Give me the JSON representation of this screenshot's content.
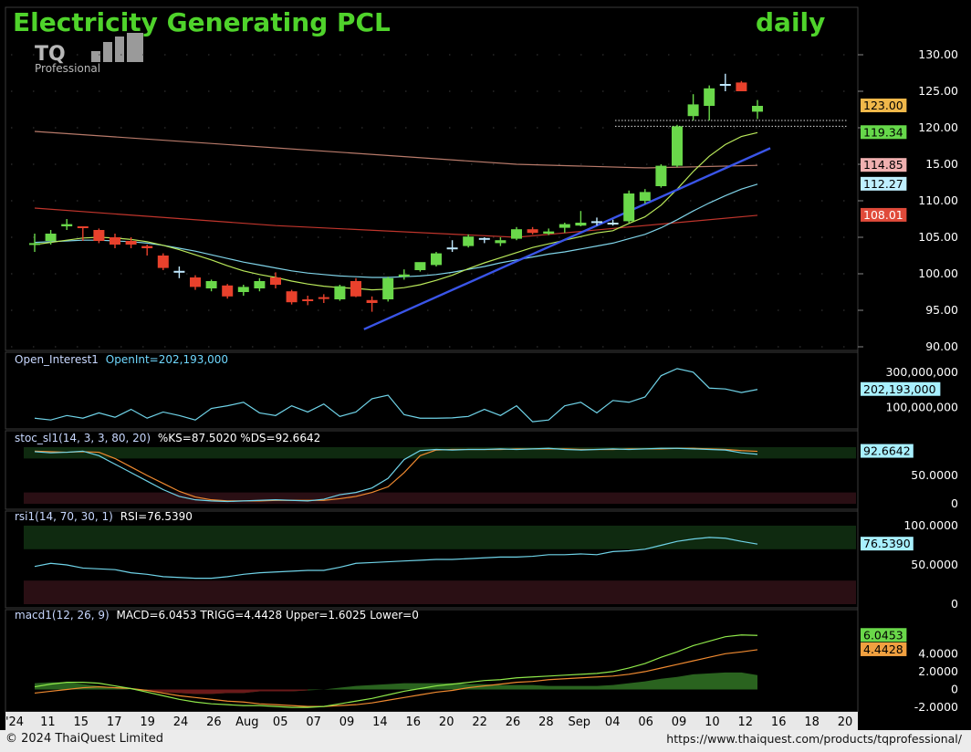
{
  "header": {
    "title": "Electricity Generating PCL",
    "period": "daily",
    "logo_text": "TQ",
    "logo_sub": "Professional"
  },
  "footer": {
    "copyright": "© 2024 ThaiQuest Limited",
    "url": "https://www.thaiquest.com/products/tqprofessional/"
  },
  "colors": {
    "background": "#000000",
    "title": "#4fd32b",
    "bull": "#6ad84a",
    "bear": "#e8412c",
    "doji": "#bfe8ff",
    "trendline": "#3a55e8",
    "ma_green": "#b9e85a",
    "ma_cyan": "#7fd3e8",
    "ma_red": "#c0352c",
    "ma_brown": "#b87a6a"
  },
  "chart_data": [
    {
      "type": "candlestick",
      "title": "Electricity Generating PCL daily",
      "x_labels": [
        "'24",
        "11",
        "15",
        "17",
        "19",
        "24",
        "26",
        "Aug",
        "05",
        "07",
        "09",
        "14",
        "16",
        "20",
        "22",
        "26",
        "28",
        "Sep",
        "04",
        "06",
        "09",
        "10",
        "12",
        "16",
        "18",
        "20"
      ],
      "ylim": [
        90,
        130
      ],
      "y_ticks": [
        "130.00",
        "125.00",
        "120.00",
        "15.00",
        "110.00",
        "105.00",
        "100.00",
        "95.00",
        "90.00"
      ],
      "candles": [
        {
          "o": 104.0,
          "h": 105.5,
          "l": 103.0,
          "c": 104.2
        },
        {
          "o": 104.5,
          "h": 106.0,
          "l": 104.0,
          "c": 105.5
        },
        {
          "o": 106.5,
          "h": 107.5,
          "l": 106.0,
          "c": 106.8
        },
        {
          "o": 106.5,
          "h": 106.5,
          "l": 104.5,
          "c": 106.3
        },
        {
          "o": 106.0,
          "h": 106.2,
          "l": 104.2,
          "c": 104.5
        },
        {
          "o": 105.0,
          "h": 105.5,
          "l": 103.5,
          "c": 104.0
        },
        {
          "o": 104.5,
          "h": 105.0,
          "l": 103.5,
          "c": 104.0
        },
        {
          "o": 103.8,
          "h": 104.0,
          "l": 102.5,
          "c": 103.5
        },
        {
          "o": 102.5,
          "h": 102.8,
          "l": 100.5,
          "c": 100.8
        },
        {
          "o": 100.4,
          "h": 101.0,
          "l": 99.4,
          "c": 100.3
        },
        {
          "o": 99.5,
          "h": 99.8,
          "l": 97.8,
          "c": 98.2
        },
        {
          "o": 98.0,
          "h": 99.2,
          "l": 97.6,
          "c": 99.0
        },
        {
          "o": 98.4,
          "h": 98.6,
          "l": 96.6,
          "c": 96.9
        },
        {
          "o": 97.5,
          "h": 98.5,
          "l": 97.0,
          "c": 98.2
        },
        {
          "o": 98.0,
          "h": 99.4,
          "l": 97.6,
          "c": 99.0
        },
        {
          "o": 99.5,
          "h": 100.2,
          "l": 98.0,
          "c": 98.5
        },
        {
          "o": 97.6,
          "h": 97.8,
          "l": 95.8,
          "c": 96.1
        },
        {
          "o": 96.5,
          "h": 97.0,
          "l": 95.7,
          "c": 96.3
        },
        {
          "o": 96.8,
          "h": 97.2,
          "l": 96.0,
          "c": 96.6
        },
        {
          "o": 96.5,
          "h": 98.5,
          "l": 96.3,
          "c": 98.3
        },
        {
          "o": 99.0,
          "h": 99.4,
          "l": 96.8,
          "c": 96.9
        },
        {
          "o": 96.4,
          "h": 96.9,
          "l": 94.8,
          "c": 96.0
        },
        {
          "o": 96.5,
          "h": 99.6,
          "l": 96.2,
          "c": 99.4
        },
        {
          "o": 99.6,
          "h": 100.6,
          "l": 99.2,
          "c": 99.9
        },
        {
          "o": 100.5,
          "h": 101.5,
          "l": 100.3,
          "c": 101.6
        },
        {
          "o": 101.2,
          "h": 103.0,
          "l": 101.0,
          "c": 102.8
        },
        {
          "o": 103.6,
          "h": 104.6,
          "l": 103.0,
          "c": 103.5
        },
        {
          "o": 103.8,
          "h": 105.4,
          "l": 103.6,
          "c": 105.1
        },
        {
          "o": 104.8,
          "h": 105.0,
          "l": 104.2,
          "c": 104.9
        },
        {
          "o": 104.2,
          "h": 105.0,
          "l": 103.8,
          "c": 104.6
        },
        {
          "o": 104.8,
          "h": 106.4,
          "l": 104.6,
          "c": 106.1
        },
        {
          "o": 106.1,
          "h": 106.4,
          "l": 105.4,
          "c": 105.6
        },
        {
          "o": 105.5,
          "h": 106.2,
          "l": 105.3,
          "c": 105.8
        },
        {
          "o": 106.3,
          "h": 107.0,
          "l": 105.6,
          "c": 106.8
        },
        {
          "o": 106.6,
          "h": 108.6,
          "l": 106.5,
          "c": 107.0
        },
        {
          "o": 107.2,
          "h": 107.7,
          "l": 106.6,
          "c": 107.2
        },
        {
          "o": 107.0,
          "h": 107.4,
          "l": 106.6,
          "c": 107.0
        },
        {
          "o": 107.2,
          "h": 111.4,
          "l": 107.0,
          "c": 111.0
        },
        {
          "o": 110.0,
          "h": 111.6,
          "l": 109.6,
          "c": 111.2
        },
        {
          "o": 112.0,
          "h": 115.0,
          "l": 111.8,
          "c": 114.8
        },
        {
          "o": 114.8,
          "h": 120.4,
          "l": 114.6,
          "c": 120.2
        },
        {
          "o": 121.6,
          "h": 124.6,
          "l": 121.0,
          "c": 123.2
        },
        {
          "o": 123.0,
          "h": 125.8,
          "l": 121.0,
          "c": 125.4
        },
        {
          "o": 126.0,
          "h": 127.4,
          "l": 125.0,
          "c": 126.0
        },
        {
          "o": 126.2,
          "h": 126.4,
          "l": 125.0,
          "c": 125.0
        },
        {
          "o": 122.2,
          "h": 123.8,
          "l": 121.2,
          "c": 123.0
        }
      ],
      "price_labels": [
        "123.00",
        "119.34",
        "114.85",
        "112.27",
        "108.01"
      ],
      "price_values": [
        123.0,
        119.34,
        114.85,
        112.27,
        108.01
      ],
      "price_label_colors": [
        "#f0b84a",
        "#66d84a",
        "#f0b0b0",
        "#bfefff",
        "#e04a3a"
      ],
      "ma_green": [
        104.0,
        104.3,
        104.6,
        104.9,
        105.0,
        104.9,
        104.7,
        104.4,
        103.9,
        103.3,
        102.6,
        101.9,
        101.1,
        100.4,
        99.9,
        99.5,
        99.0,
        98.6,
        98.3,
        98.1,
        98.0,
        97.8,
        97.9,
        98.1,
        98.5,
        99.1,
        99.8,
        100.7,
        101.5,
        102.2,
        102.9,
        103.6,
        104.1,
        104.6,
        105.1,
        105.6,
        105.9,
        106.9,
        107.8,
        109.4,
        111.6,
        114.0,
        116.1,
        117.7,
        118.8,
        119.34
      ],
      "ma_cyan": [
        104.3,
        104.4,
        104.5,
        104.6,
        104.6,
        104.5,
        104.4,
        104.2,
        103.9,
        103.5,
        103.1,
        102.6,
        102.1,
        101.6,
        101.2,
        100.8,
        100.4,
        100.1,
        99.9,
        99.7,
        99.6,
        99.5,
        99.5,
        99.6,
        99.7,
        99.9,
        100.2,
        100.6,
        101.0,
        101.5,
        101.9,
        102.3,
        102.7,
        103.0,
        103.4,
        103.8,
        104.2,
        104.8,
        105.4,
        106.3,
        107.4,
        108.6,
        109.7,
        110.7,
        111.6,
        112.27
      ],
      "ma_red_x": [
        0,
        15,
        30,
        45
      ],
      "ma_red": [
        109.0,
        106.6,
        105.0,
        108.01
      ],
      "ma_brown_x": [
        0,
        30,
        38,
        45
      ],
      "ma_brown": [
        119.5,
        115.0,
        114.5,
        114.85
      ],
      "trendline": {
        "x": [
          20.5,
          45.8
        ],
        "y": [
          92.4,
          117.2
        ]
      },
      "resistance_lines": [
        121.0,
        120.2
      ]
    },
    {
      "type": "line",
      "title": "Open_Interest1",
      "label": "OpenInt=202,193,000",
      "ylim": [
        0,
        340000000
      ],
      "y_ticks": [
        "300,000,000",
        "202,193,000",
        "100,000,000"
      ],
      "y_tick_values": [
        300000000,
        202193000,
        100000000
      ],
      "values": [
        40000000,
        30000000,
        55000000,
        40000000,
        70000000,
        45000000,
        90000000,
        40000000,
        75000000,
        55000000,
        30000000,
        95000000,
        110000000,
        130000000,
        70000000,
        55000000,
        110000000,
        75000000,
        120000000,
        50000000,
        75000000,
        150000000,
        170000000,
        60000000,
        40000000,
        40000000,
        42000000,
        50000000,
        90000000,
        55000000,
        110000000,
        20000000,
        30000000,
        110000000,
        130000000,
        70000000,
        140000000,
        130000000,
        160000000,
        280000000,
        320000000,
        300000000,
        210000000,
        205000000,
        185000000,
        202193000
      ]
    },
    {
      "type": "line",
      "title": "stoc_sl1(14, 3, 3, 80, 20)",
      "label": "%KS=87.5020 %DS=92.6642",
      "ylim": [
        0,
        100
      ],
      "y_ticks": [
        "92.6642",
        "50.0000",
        "0"
      ],
      "y_tick_values": [
        92.6642,
        50,
        0
      ],
      "zones": [
        [
          80,
          100
        ],
        [
          0,
          20
        ]
      ],
      "ks": [
        92,
        90,
        91,
        93,
        85,
        70,
        55,
        40,
        25,
        13,
        7,
        5,
        4,
        5,
        6,
        7,
        6,
        5,
        8,
        16,
        20,
        28,
        45,
        78,
        94,
        96,
        95,
        96,
        96,
        97,
        96,
        97,
        98,
        96,
        95,
        96,
        97,
        96,
        97,
        98,
        98,
        97,
        96,
        95,
        90,
        87.502
      ],
      "ds": [
        93,
        92,
        91,
        92,
        91,
        80,
        65,
        50,
        36,
        22,
        12,
        7,
        5,
        5,
        5,
        6,
        6,
        6,
        6,
        9,
        13,
        20,
        30,
        55,
        85,
        95,
        96,
        96,
        96,
        96,
        97,
        97,
        97,
        97,
        96,
        96,
        96,
        97,
        97,
        97,
        98,
        98,
        97,
        96,
        94,
        92.6642
      ]
    },
    {
      "type": "line",
      "title": "rsi1(14, 70, 30, 1)",
      "label": "RSI=76.5390",
      "ylim": [
        0,
        100
      ],
      "y_ticks": [
        "100.0000",
        "76.5390",
        "50.0000",
        "0"
      ],
      "y_tick_values": [
        100,
        76.539,
        50,
        0
      ],
      "zones": [
        [
          70,
          100
        ],
        [
          0,
          30
        ]
      ],
      "values": [
        48,
        52,
        50,
        46,
        45,
        44,
        40,
        38,
        35,
        34,
        33,
        33,
        35,
        38,
        40,
        41,
        42,
        43,
        43,
        47,
        52,
        53,
        54,
        55,
        56,
        57,
        57,
        58,
        59,
        60,
        60,
        61,
        63,
        63,
        64,
        63,
        67,
        68,
        70,
        75,
        80,
        83,
        85,
        84,
        80,
        76.539
      ]
    },
    {
      "type": "line",
      "title": "macd1(12, 26, 9)",
      "label": "MACD=6.0453 TRIGG=4.4428 Upper=1.6025 Lower=0",
      "ylim": [
        -2.5,
        7.5
      ],
      "y_ticks": [
        "6.0453",
        "4.4428",
        "4.0000",
        "2.0000",
        "0",
        "-2.0000"
      ],
      "y_tick_values": [
        6.0453,
        4.4428,
        4,
        2,
        0,
        -2
      ],
      "macd": [
        0.3,
        0.6,
        0.8,
        0.8,
        0.7,
        0.4,
        0.1,
        -0.3,
        -0.7,
        -1.1,
        -1.4,
        -1.6,
        -1.7,
        -1.8,
        -1.8,
        -1.9,
        -2.0,
        -2.0,
        -1.9,
        -1.6,
        -1.3,
        -1.0,
        -0.6,
        -0.2,
        0.1,
        0.4,
        0.6,
        0.8,
        1.0,
        1.1,
        1.3,
        1.4,
        1.5,
        1.6,
        1.7,
        1.8,
        2.0,
        2.4,
        2.9,
        3.6,
        4.2,
        4.9,
        5.4,
        5.9,
        6.1,
        6.0453
      ],
      "trigg": [
        -0.4,
        -0.2,
        0.0,
        0.2,
        0.3,
        0.2,
        0.1,
        -0.1,
        -0.4,
        -0.7,
        -0.9,
        -1.1,
        -1.3,
        -1.4,
        -1.6,
        -1.7,
        -1.8,
        -1.9,
        -1.9,
        -1.8,
        -1.7,
        -1.5,
        -1.2,
        -0.9,
        -0.6,
        -0.3,
        -0.1,
        0.2,
        0.4,
        0.6,
        0.8,
        0.9,
        1.1,
        1.2,
        1.3,
        1.4,
        1.5,
        1.7,
        2.0,
        2.4,
        2.8,
        3.2,
        3.6,
        4.0,
        4.2,
        4.4428
      ],
      "histogram": [
        0.7,
        0.8,
        0.8,
        0.6,
        0.4,
        0.2,
        0.0,
        -0.2,
        -0.3,
        -0.4,
        -0.5,
        -0.5,
        -0.4,
        -0.4,
        -0.2,
        -0.2,
        -0.2,
        -0.1,
        0.0,
        0.2,
        0.4,
        0.5,
        0.6,
        0.7,
        0.7,
        0.7,
        0.7,
        0.6,
        0.6,
        0.5,
        0.5,
        0.5,
        0.4,
        0.4,
        0.4,
        0.4,
        0.5,
        0.7,
        0.9,
        1.2,
        1.4,
        1.7,
        1.8,
        1.9,
        1.9,
        1.6025
      ]
    }
  ]
}
